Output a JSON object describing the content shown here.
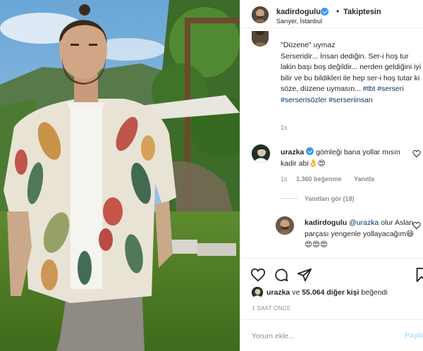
{
  "header": {
    "username": "kadirdogulu",
    "separator": "•",
    "follow_status": "Takiptesin",
    "location": "Sarıyer, İstanbul"
  },
  "caption": {
    "line1": "\"Düzene\" uymaz",
    "body": "Serseridir... İnsan dediğin. Ser-i hoş tur lakin başı boş değildir... nerden geldiğini iyi bilir ve bu bildikleri ile hep ser-i hoş tutar ki söze, düzene uymasın...",
    "hashtags": "#tbt #serseri #serserisözler #serseriinsan",
    "timestamp": "1s"
  },
  "comments": [
    {
      "username": "urazka",
      "text": "gömleği bana yollar mısın kadir abi👌😍",
      "time": "1s",
      "likes": "1.360 beğenme",
      "reply_label": "Yanıtla"
    }
  ],
  "replies_toggle": "Yanıtları gör (18)",
  "reply": {
    "username": "kadirdogulu",
    "mention": "@urazka",
    "text": "olur Aslan parçası yengenle yollayacağım😆😍😍😍"
  },
  "likes": {
    "first_user": "urazka",
    "connector": "ve",
    "others": "55.064 diğer kişi",
    "suffix": "beğendi"
  },
  "time_ago": "1 SAAT ÖNCE",
  "comment_input": {
    "placeholder": "Yorum ekle...",
    "post_label": "Paylaş"
  },
  "icons": {
    "like": "heart-icon",
    "comment": "comment-icon",
    "share": "paper-plane-icon",
    "save": "bookmark-icon",
    "verified": "verified-badge-icon"
  },
  "colors": {
    "link": "#00376b",
    "verified": "#3897f0",
    "muted": "#8e8e8e",
    "post_disabled": "#b2dffc"
  }
}
